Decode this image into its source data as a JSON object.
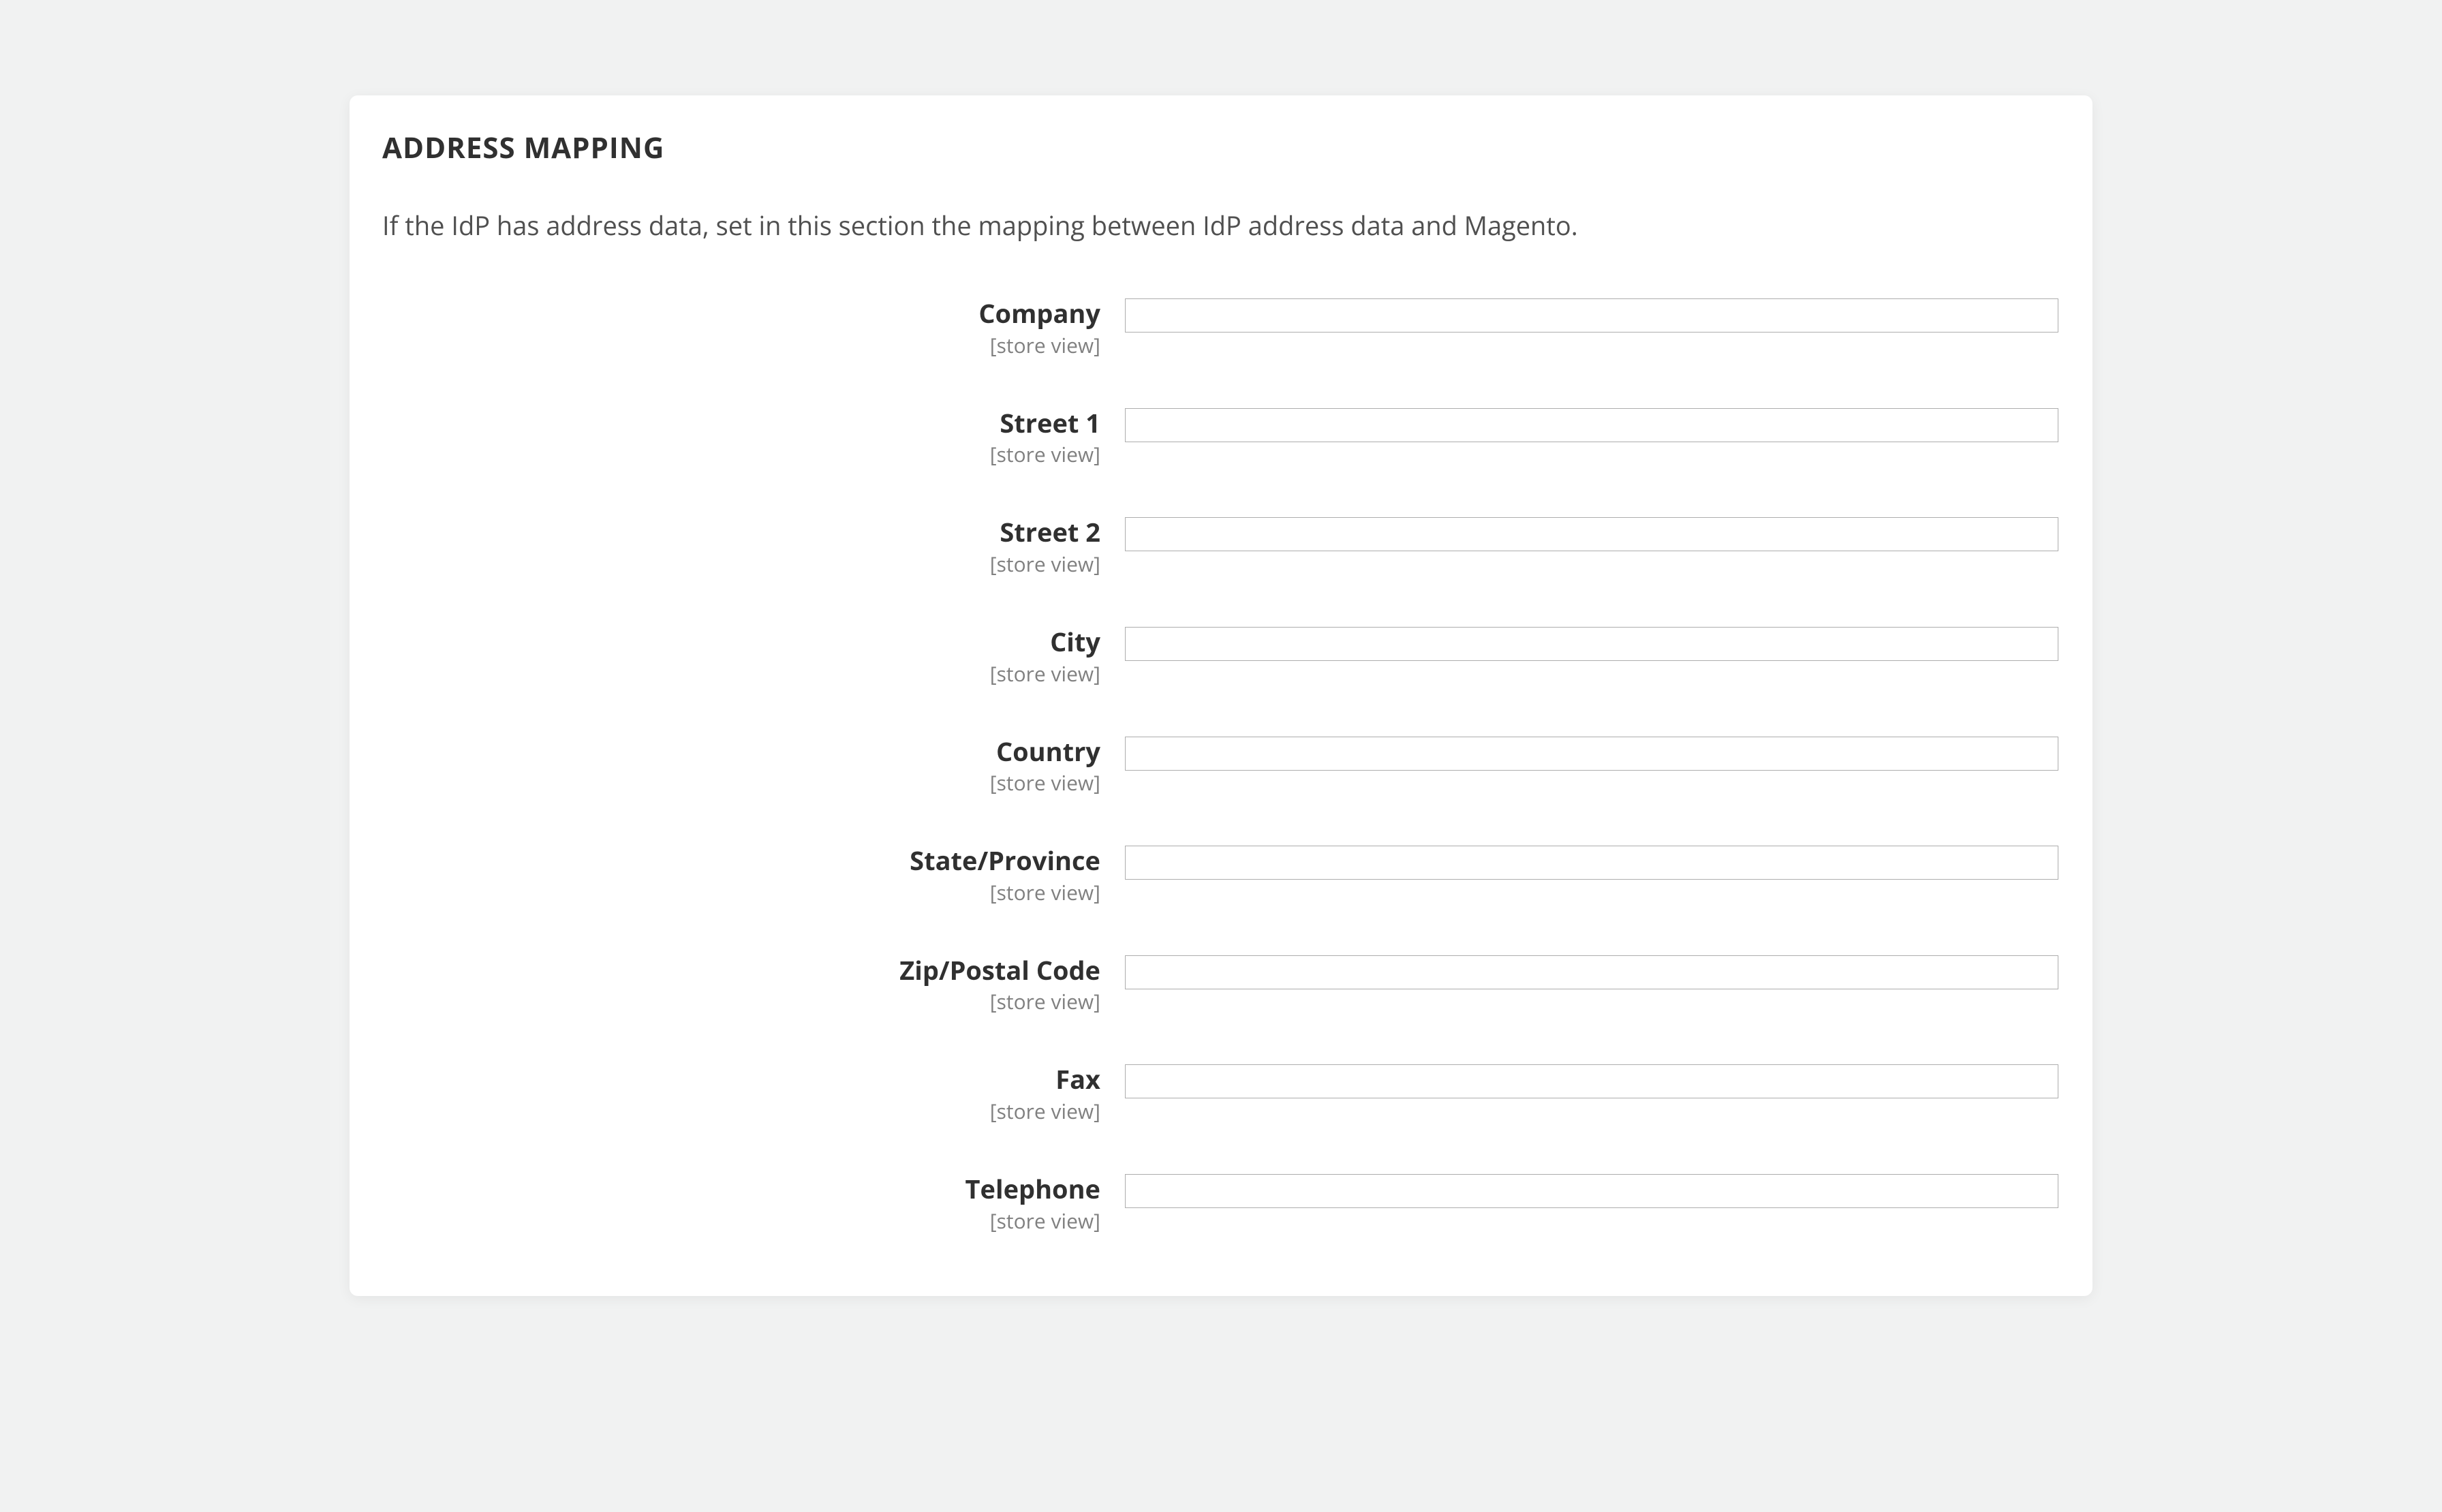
{
  "section": {
    "title": "ADDRESS MAPPING",
    "description": "If the IdP has address data, set in this section the mapping between IdP address data and Magento."
  },
  "scope_text": "[store view]",
  "fields": {
    "company": {
      "label": "Company",
      "value": ""
    },
    "street1": {
      "label": "Street 1",
      "value": ""
    },
    "street2": {
      "label": "Street 2",
      "value": ""
    },
    "city": {
      "label": "City",
      "value": ""
    },
    "country": {
      "label": "Country",
      "value": ""
    },
    "state_province": {
      "label": "State/Province",
      "value": ""
    },
    "zip_postal": {
      "label": "Zip/Postal Code",
      "value": ""
    },
    "fax": {
      "label": "Fax",
      "value": ""
    },
    "telephone": {
      "label": "Telephone",
      "value": ""
    }
  }
}
